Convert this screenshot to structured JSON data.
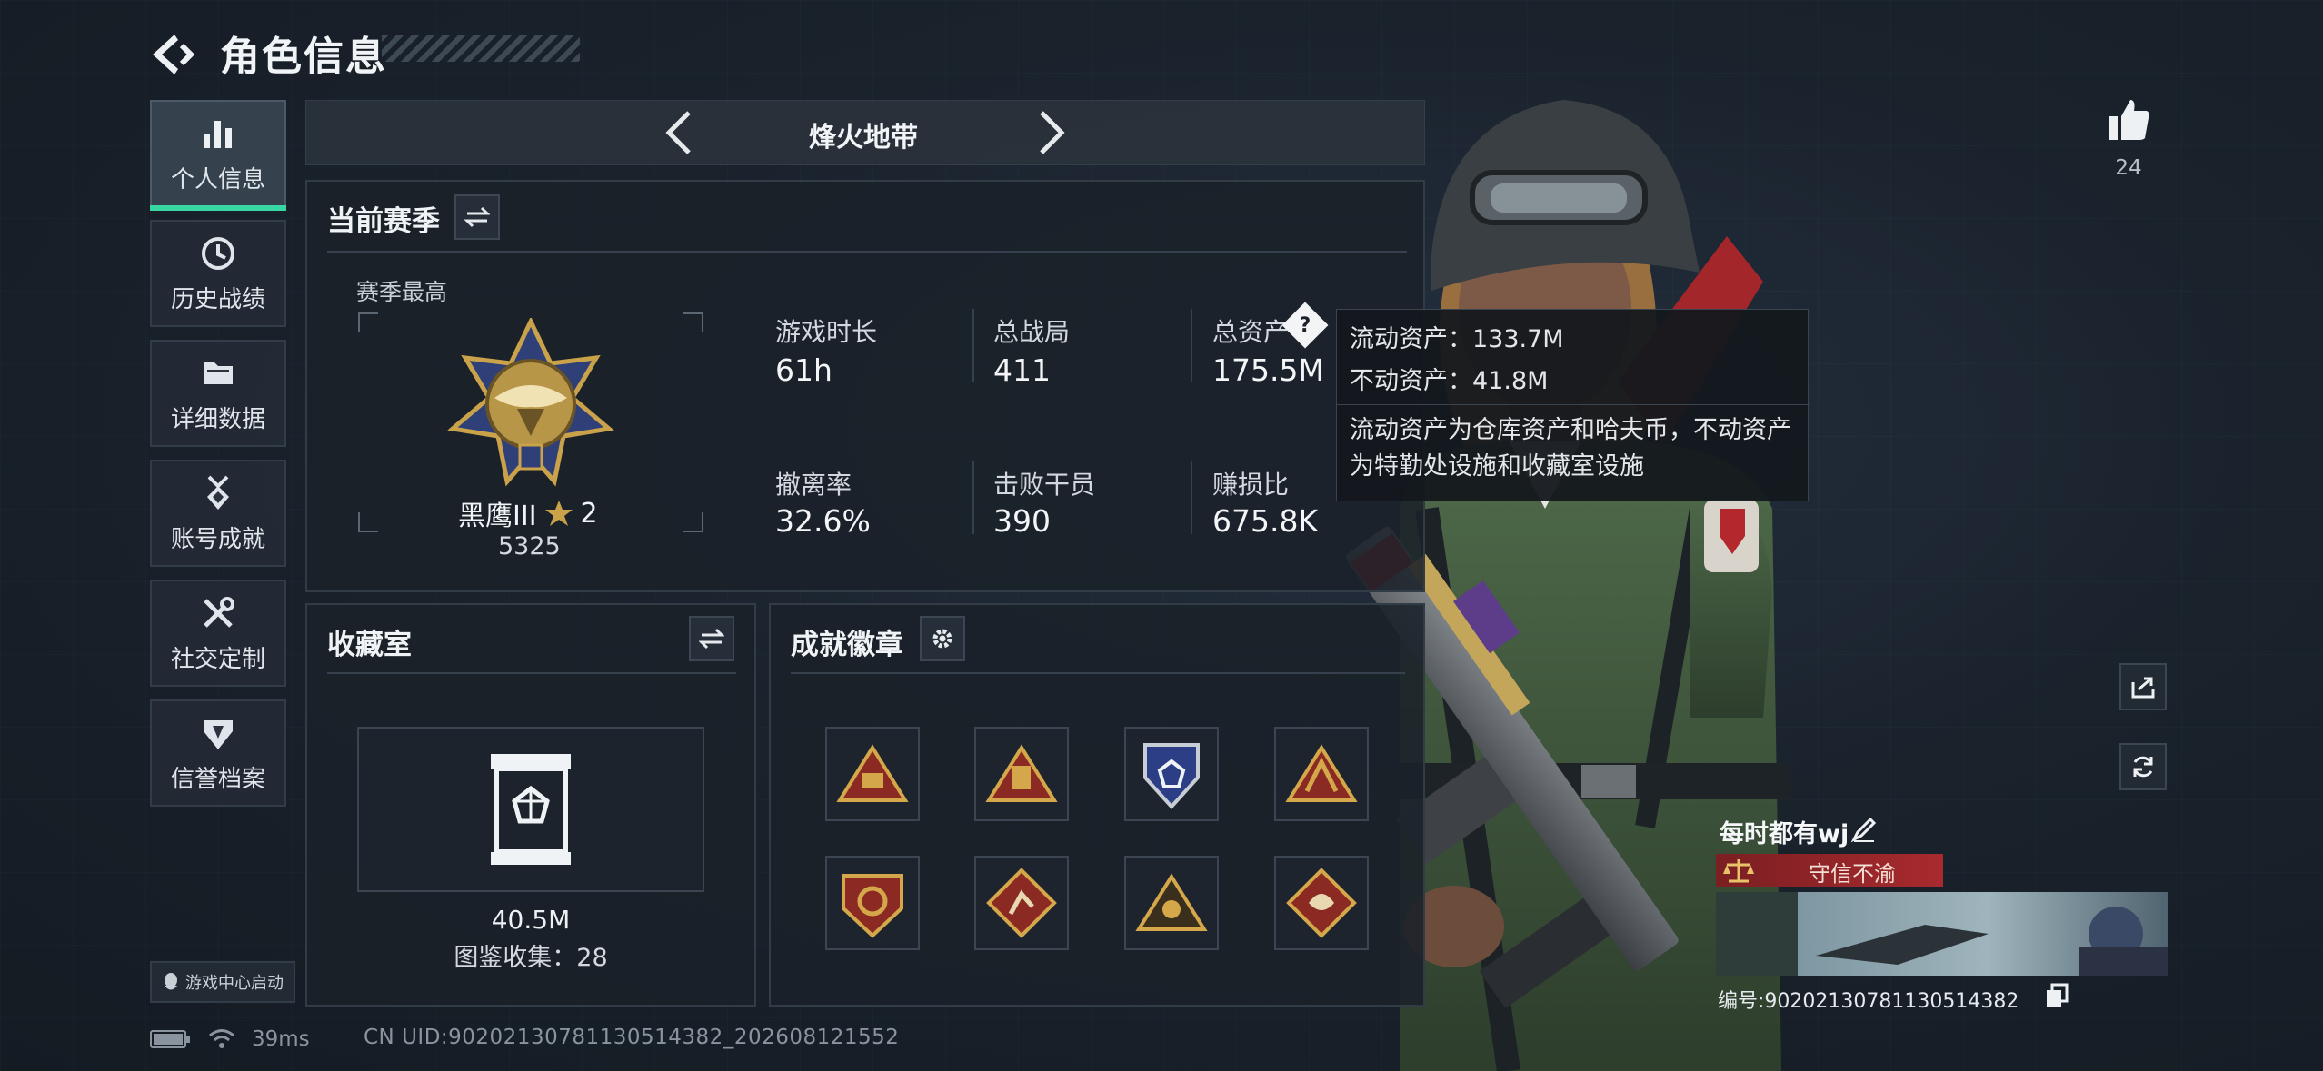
{
  "header": {
    "title": "角色信息"
  },
  "sidebar": {
    "items": [
      {
        "label": "个人信息",
        "active": true
      },
      {
        "label": "历史战绩"
      },
      {
        "label": "详细数据"
      },
      {
        "label": "账号成就"
      },
      {
        "label": "社交定制"
      },
      {
        "label": "信誉档案"
      }
    ],
    "launch_label": "游戏中心启动"
  },
  "mode": {
    "title": "烽火地带"
  },
  "season": {
    "title": "当前赛季",
    "highest_label": "赛季最高",
    "rank_name": "黑鹰III",
    "rank_stars": "2",
    "rank_score": "5325",
    "stats": [
      {
        "label": "游戏时长",
        "value": "61h"
      },
      {
        "label": "总战局",
        "value": "411"
      },
      {
        "label": "总资产",
        "value": "175.5M"
      },
      {
        "label": "撤离率",
        "value": "32.6%"
      },
      {
        "label": "击败干员",
        "value": "390"
      },
      {
        "label": "赚损比",
        "value": "675.8K"
      }
    ]
  },
  "tooltip": {
    "liquid": "流动资产：133.7M",
    "fixed": "不动资产：41.8M",
    "desc1": "流动资产为仓库资产和哈夫币，不动资产",
    "desc2": "为特勤处设施和收藏室设施"
  },
  "collection": {
    "title": "收藏室",
    "value": "40.5M",
    "count_label": "图鉴收集：28"
  },
  "achievements": {
    "title": "成就徽章"
  },
  "likes": {
    "count": "24"
  },
  "player": {
    "name": "每时都有wj",
    "honor": "守信不渝",
    "id_text": "编号:9020213078113051438​2"
  },
  "status": {
    "ping": "39ms",
    "uid": "CN UID:9020213078113051438​2_202608121552"
  },
  "colors": {
    "accent": "#37d6a3",
    "honor": "#a82a2e",
    "gold": "#c9a24a"
  },
  "icons": [
    "back-icon",
    "bar-chart-icon",
    "clock-icon",
    "folder-icon",
    "medal-icon",
    "tools-icon",
    "shield-icon",
    "swap-icon",
    "gear-icon",
    "help-icon",
    "thumbs-up-icon",
    "share-icon",
    "refresh-icon",
    "edit-icon",
    "copy-icon",
    "battery-icon",
    "wifi-icon",
    "qq-icon"
  ]
}
